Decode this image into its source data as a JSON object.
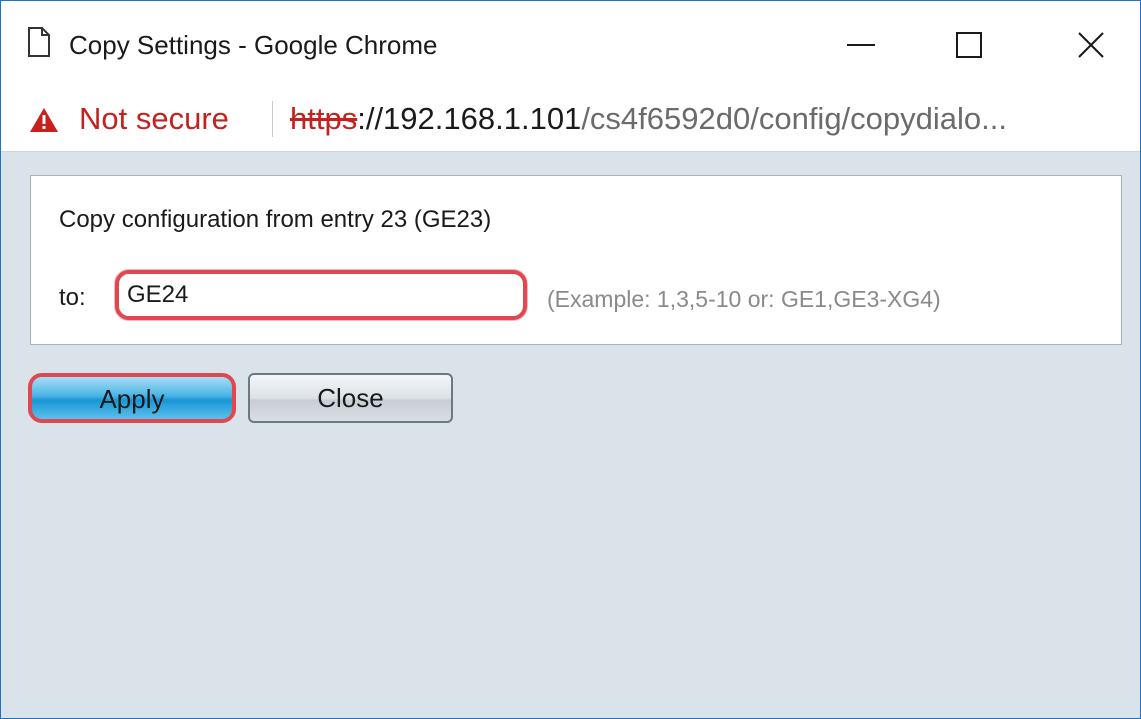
{
  "window": {
    "title": "Copy Settings - Google Chrome",
    "icons": {
      "page": "page-icon",
      "minimize": "minimize-icon",
      "maximize": "maximize-icon",
      "close": "close-icon"
    }
  },
  "addressbar": {
    "security_label": "Not secure",
    "security_icon": "warning-triangle-icon",
    "url_scheme": "https",
    "url_host": "://192.168.1.101",
    "url_path": "/cs4f6592d0/config/copydialo..."
  },
  "dialog": {
    "heading": "Copy configuration from entry 23 (GE23)",
    "to_label": "to:",
    "to_value": "GE24",
    "hint": "(Example: 1,3,5-10 or: GE1,GE3-XG4)"
  },
  "buttons": {
    "apply": "Apply",
    "close": "Close"
  },
  "colors": {
    "warning": "#c5221f",
    "content_background": "#dae2ea",
    "highlight": "#e0474f",
    "apply_button": "#1896d5"
  }
}
